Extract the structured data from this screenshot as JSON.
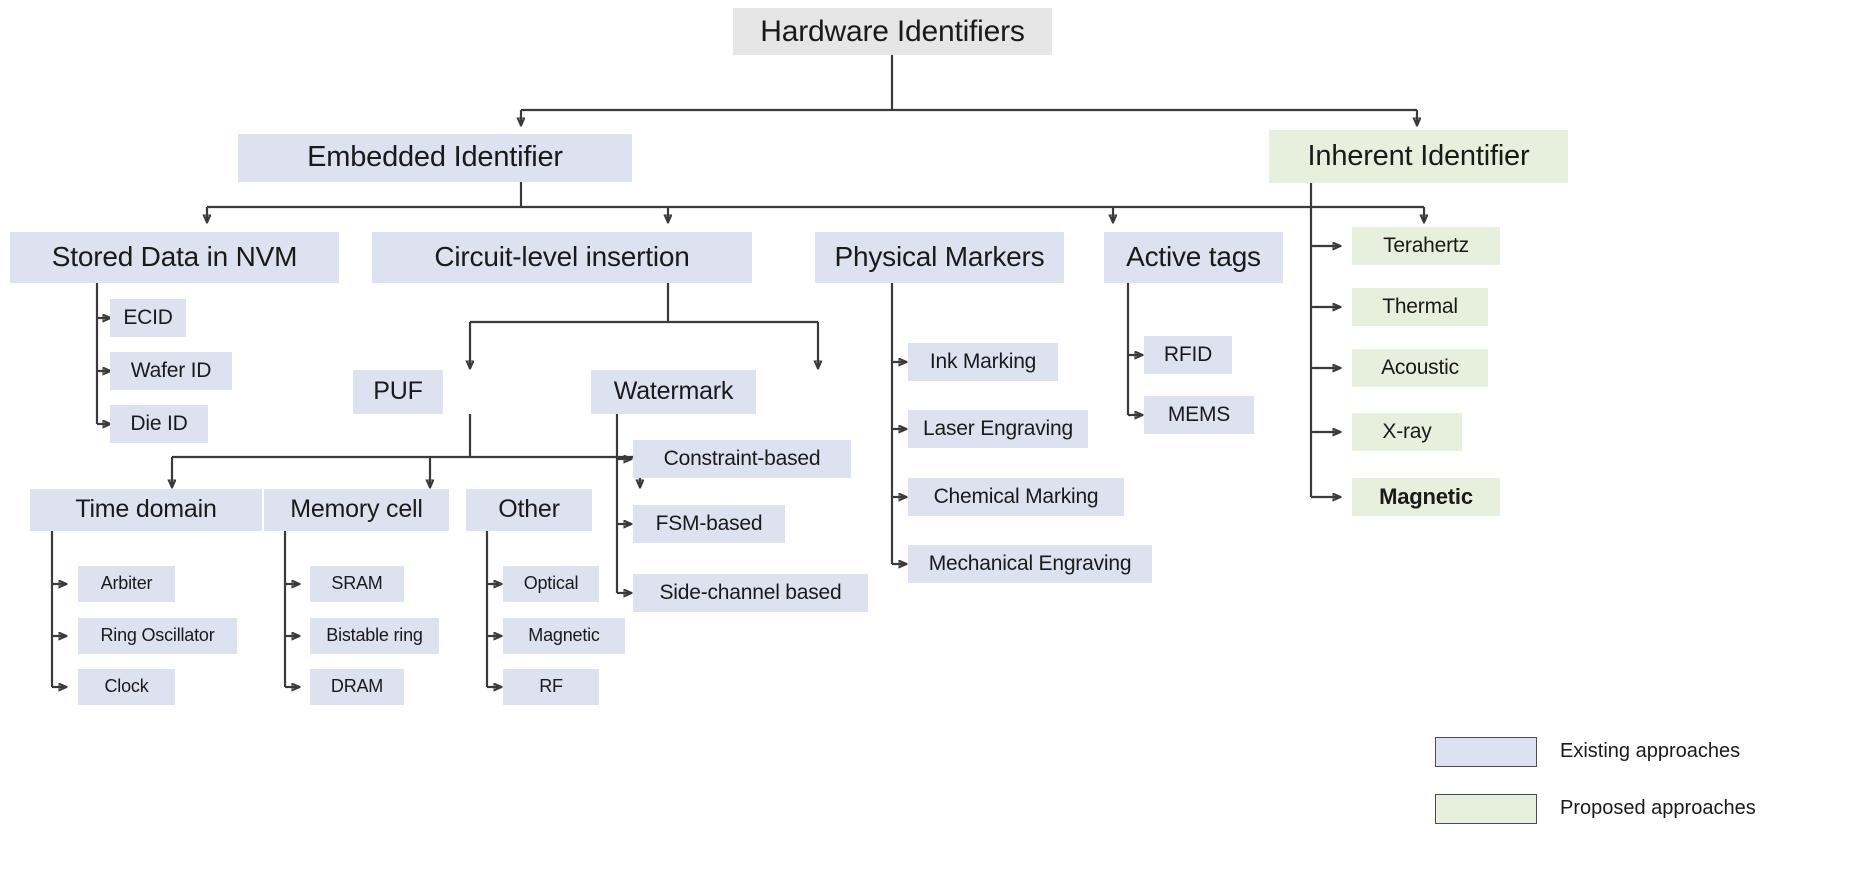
{
  "diagram": {
    "title": "Hardware Identifiers",
    "colors": {
      "root_fill": "#e7e6e6",
      "existing_fill": "#dde2f0",
      "proposed_fill": "#e7efdd",
      "line": "#3a3a3a",
      "text": "#1a1a1a"
    }
  },
  "root": {
    "label": "Hardware Identifiers"
  },
  "level2": {
    "embedded": {
      "label": "Embedded Identifier"
    },
    "inherent": {
      "label": "Inherent Identifier"
    }
  },
  "level3": {
    "stored_data": {
      "label": "Stored Data in NVM"
    },
    "circuit_level": {
      "label": "Circuit-level insertion"
    },
    "physical_markers": {
      "label": "Physical Markers"
    },
    "active_tags": {
      "label": "Active tags"
    }
  },
  "stored_data_children": [
    {
      "label": "ECID"
    },
    {
      "label": "Wafer ID"
    },
    {
      "label": "Die ID"
    }
  ],
  "circuit_children": {
    "puf": {
      "label": "PUF"
    },
    "watermark": {
      "label": "Watermark"
    }
  },
  "puf_children": [
    {
      "label": "Time domain"
    },
    {
      "label": "Memory cell"
    },
    {
      "label": "Other"
    }
  ],
  "time_domain_children": [
    {
      "label": "Arbiter"
    },
    {
      "label": "Ring Oscillator"
    },
    {
      "label": "Clock"
    }
  ],
  "memory_cell_children": [
    {
      "label": "SRAM"
    },
    {
      "label": "Bistable ring"
    },
    {
      "label": "DRAM"
    }
  ],
  "other_children": [
    {
      "label": "Optical"
    },
    {
      "label": "Magnetic"
    },
    {
      "label": "RF"
    }
  ],
  "watermark_children": [
    {
      "label": "Constraint-based"
    },
    {
      "label": "FSM-based"
    },
    {
      "label": "Side-channel based"
    }
  ],
  "physical_markers_children": [
    {
      "label": "Ink Marking"
    },
    {
      "label": "Laser Engraving"
    },
    {
      "label": "Chemical Marking"
    },
    {
      "label": "Mechanical Engraving"
    }
  ],
  "active_tags_children": [
    {
      "label": "RFID"
    },
    {
      "label": "MEMS"
    }
  ],
  "inherent_children": [
    {
      "label": "Terahertz"
    },
    {
      "label": "Thermal"
    },
    {
      "label": "Acoustic"
    },
    {
      "label": "X-ray"
    },
    {
      "label": "Magnetic"
    }
  ],
  "legend": {
    "items": [
      {
        "label": "Existing approaches",
        "color": "#dde2f0"
      },
      {
        "label": "Proposed approaches",
        "color": "#e7efdd"
      }
    ]
  }
}
